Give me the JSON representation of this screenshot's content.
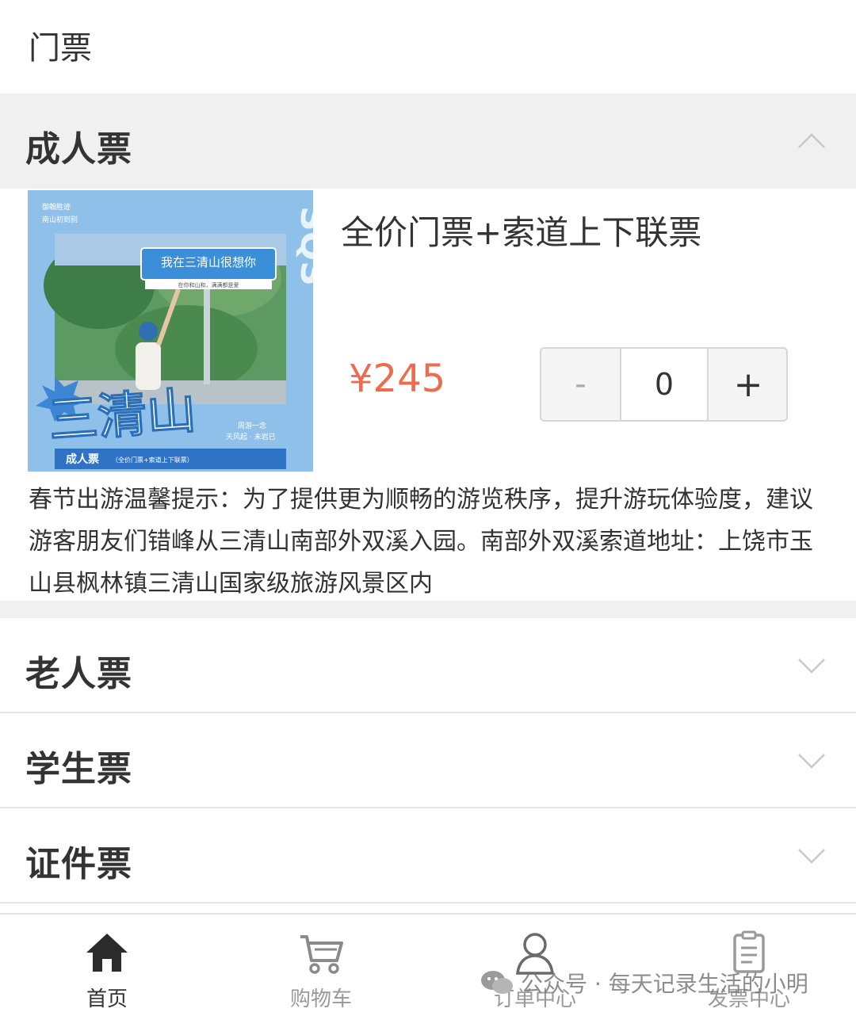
{
  "page": {
    "title": "门票"
  },
  "categories": [
    {
      "label": "成人票",
      "expanded": true
    },
    {
      "label": "老人票",
      "expanded": false
    },
    {
      "label": "学生票",
      "expanded": false
    },
    {
      "label": "证件票",
      "expanded": false
    }
  ],
  "ticket": {
    "name": "全价门票+索道上下联票",
    "price": "¥245",
    "quantity": "0",
    "minus_label": "-",
    "plus_label": "+",
    "description": "春节出游温馨提示：为了提供更为顺畅的游览秩序，提升游玩体验度，建议游客朋友们错峰从三清山南部外双溪入园。南部外双溪索道地址：上饶市玉山县枫林镇三清山国家级旅游风景区内",
    "image": {
      "corner_text_1": "御翰胜迹",
      "corner_text_2": "南山初到别",
      "side_text": "SQS",
      "sign_text": "我在三清山很想你",
      "sign_subtext": "在你和山和，满满都是爱",
      "big_title": "三清山",
      "small_right_1": "周游一念",
      "small_right_2": "天风起 · 未岩已",
      "banner_title": "成人票",
      "banner_sub": "（全价门票+索道上下联票）"
    }
  },
  "tabbar": [
    {
      "label": "首页",
      "icon": "home-icon",
      "active": true
    },
    {
      "label": "购物车",
      "icon": "cart-icon",
      "active": false
    },
    {
      "label": "订单中心",
      "icon": "user-icon",
      "active": false
    },
    {
      "label": "发票中心",
      "icon": "invoice-icon",
      "active": false
    }
  ],
  "watermark": {
    "text": "公众号 · 每天记录生活的小明",
    "icon": "wechat-icon"
  },
  "colors": {
    "price": "#ee6b4d",
    "header_bg": "#f0f0f0",
    "image_blue": "#8fc0ea"
  }
}
